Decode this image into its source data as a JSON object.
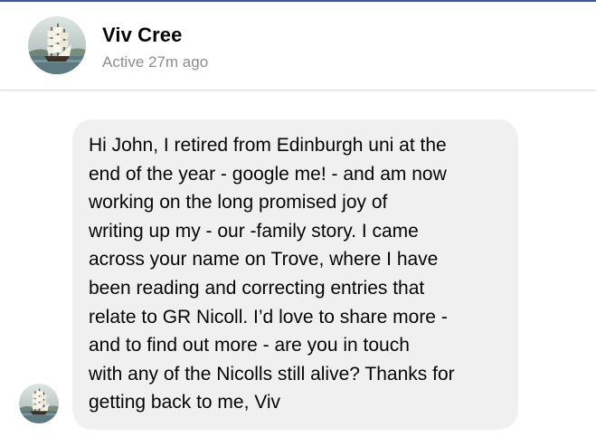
{
  "contact": {
    "name": "Viv Cree",
    "status": "Active 27m ago",
    "avatar_icon": "tall-ship-painting-avatar"
  },
  "message": {
    "text": "Hi John, I retired from Edinburgh uni at the\nend of the year - google me! - and am now\nworking on the long promised joy of\nwriting up my - our -family story. I came\nacross your name on Trove, where I have\nbeen reading and correcting entries that\nrelate to GR Nicoll. I’d love to share more -\nand to find out more - are you in touch\nwith any of the Nicolls still alive? Thanks for\ngetting back to me, Viv",
    "sender_avatar_icon": "tall-ship-painting-avatar"
  },
  "colors": {
    "bubble_background": "#f0f0f0",
    "text": "#050505",
    "muted_text": "#8a8d91",
    "top_border": "#3b5998"
  }
}
